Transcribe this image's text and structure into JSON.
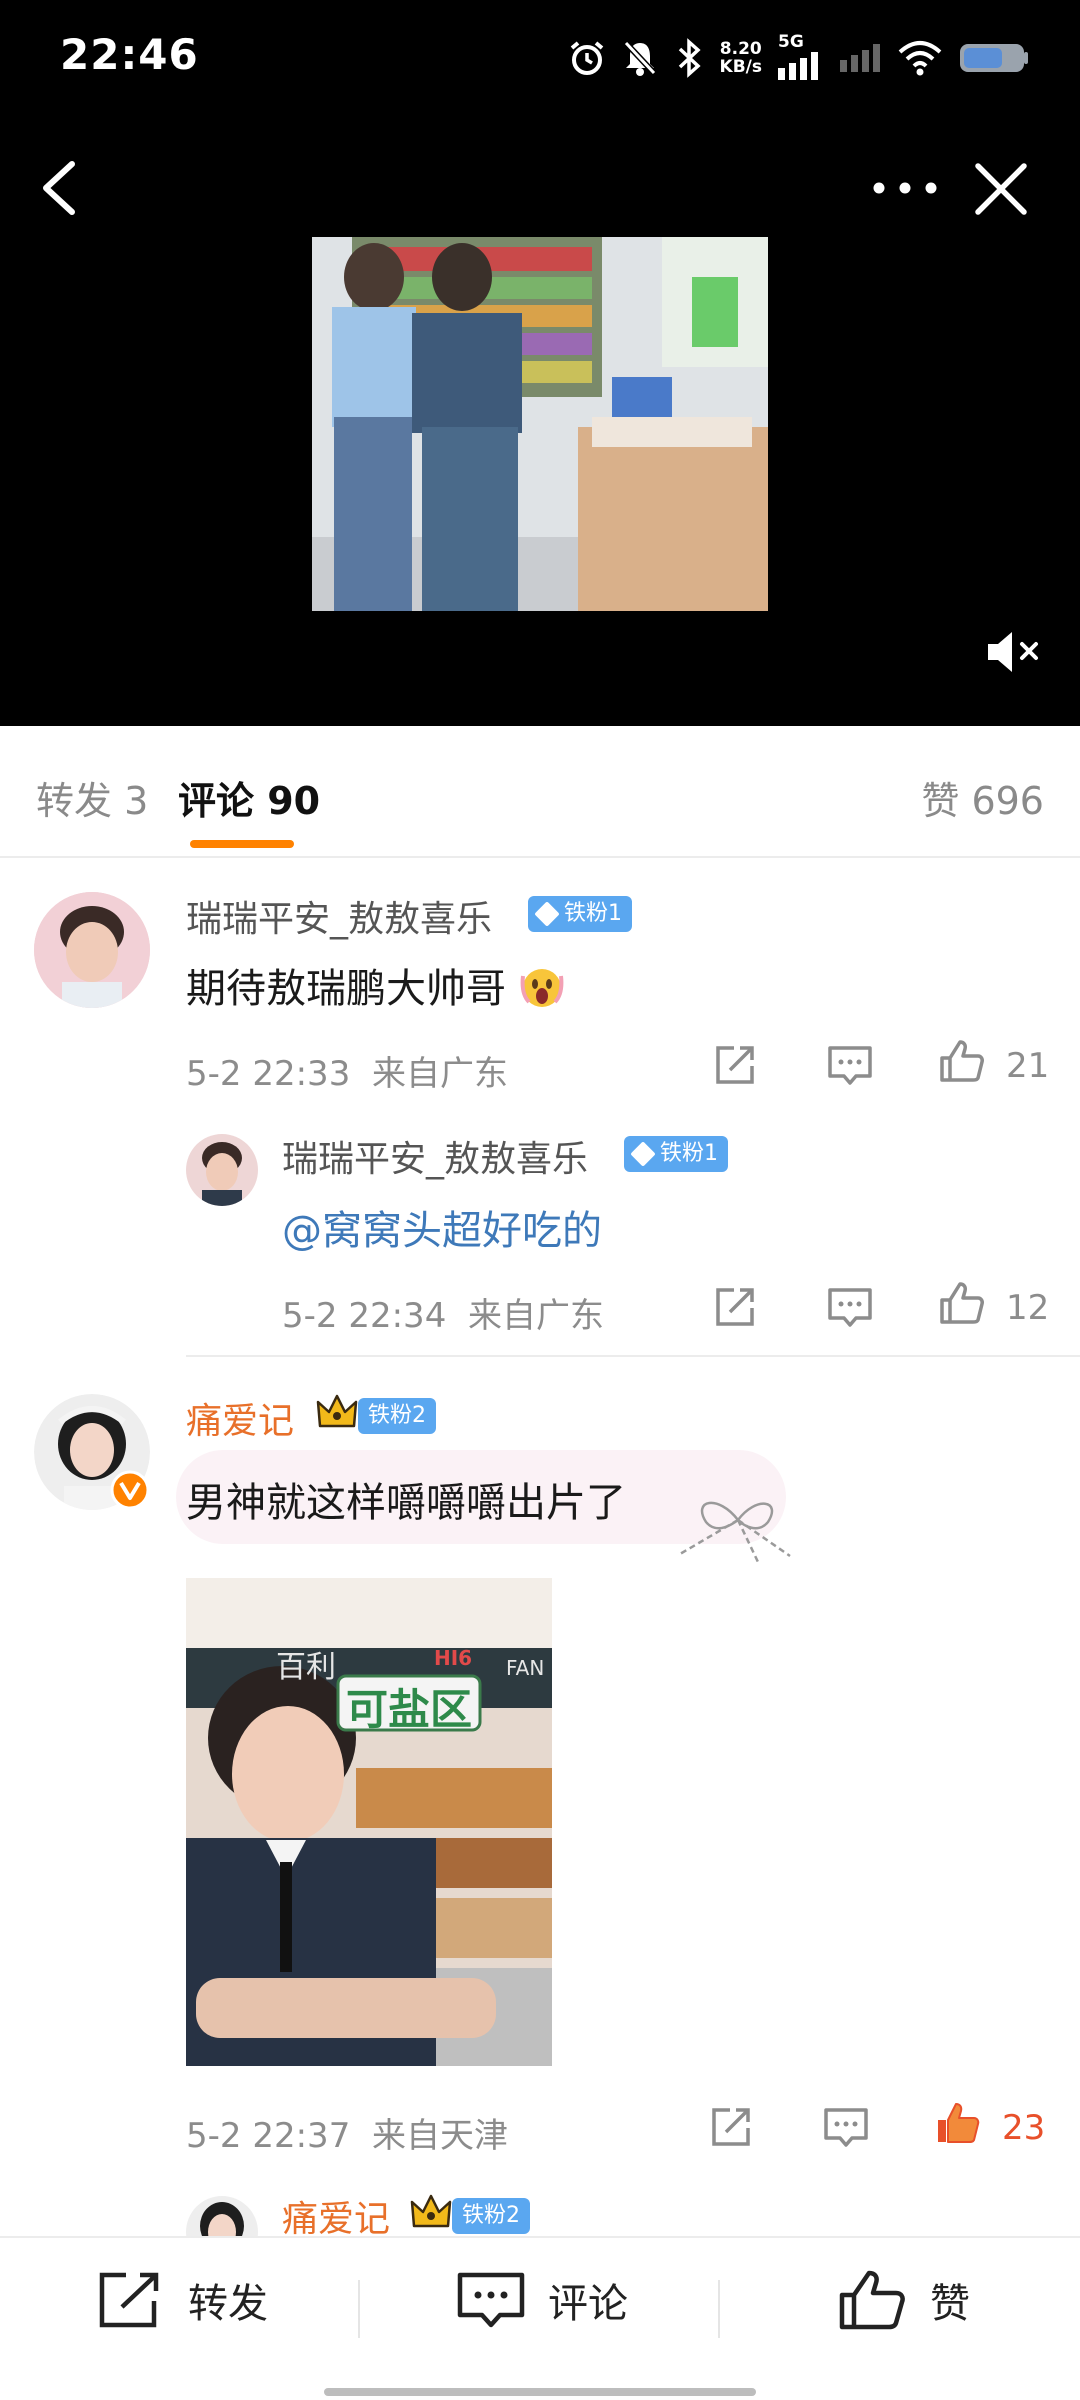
{
  "status_bar": {
    "time": "22:46",
    "speed_value": "8.20",
    "speed_unit": "KB/s",
    "network": "5G",
    "icons": [
      "alarm-icon",
      "mute-bell-icon",
      "bluetooth-icon",
      "signal-icon",
      "wifi-icon",
      "battery-icon"
    ]
  },
  "header": {
    "icons": [
      "back-icon",
      "more-icon",
      "close-icon"
    ]
  },
  "video": {
    "muted": true,
    "icons": [
      "mute-speaker-icon"
    ]
  },
  "tabs": {
    "repost": "转发 3",
    "comments": "评论 90",
    "likes": "赞 696",
    "active_color": "#ff8200"
  },
  "comments": [
    {
      "user": "瑞瑞平安_敖敖喜乐",
      "badge": "铁粉1",
      "text": "期待敖瑞鹏大帅哥",
      "emoji": "scream-face-icon",
      "time": "5-2 22:33",
      "location": "来自广东",
      "likes": "21",
      "reply": {
        "user": "瑞瑞平安_敖敖喜乐",
        "badge": "铁粉1",
        "text": "@窝窝头超好吃的",
        "time": "5-2 22:34",
        "location": "来自广东",
        "likes": "12"
      }
    },
    {
      "user": "痛爱记",
      "badge": "铁粉2",
      "verified": true,
      "text": "男神就这样嚼嚼嚼出片了",
      "image_text": "可盐区",
      "image_tag": "HI6",
      "image_sign": "FAN",
      "image_sign_left": "百利",
      "time": "5-2 22:37",
      "location": "来自天津",
      "likes": "23",
      "liked": true,
      "reply_preview": {
        "user": "痛爱记",
        "badge": "铁粉2"
      }
    }
  ],
  "bottom_bar": {
    "repost": "转发",
    "comment": "评论",
    "like": "赞"
  },
  "colors": {
    "accent": "#ff8200",
    "link": "#3e79b9",
    "badge": "#5aa7f0",
    "vip_name": "#e8702a"
  }
}
